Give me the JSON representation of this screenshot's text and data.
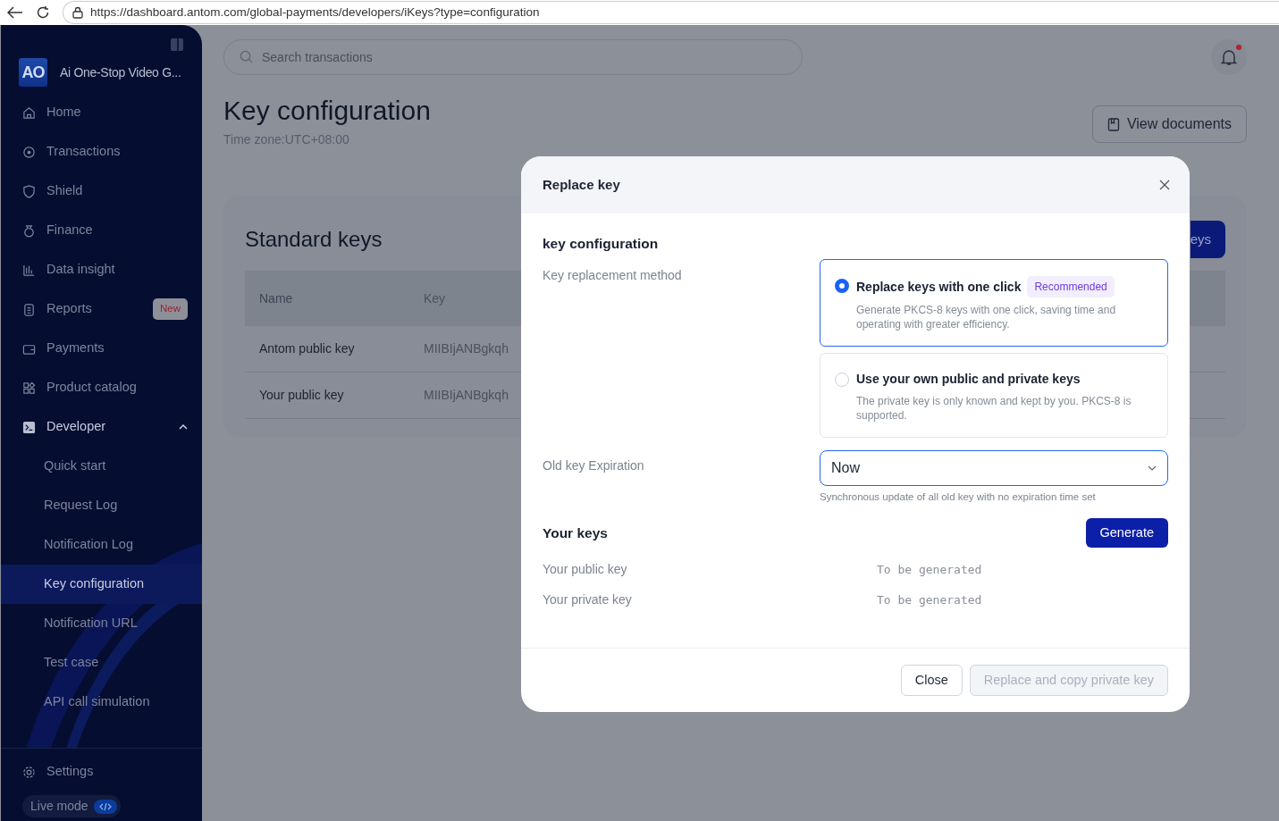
{
  "browser": {
    "url": "https://dashboard.antom.com/global-payments/developers/iKeys?type=configuration"
  },
  "sidebar": {
    "logo": "AO",
    "merchant": "Ai One-Stop Video G...",
    "items": [
      {
        "label": "Home",
        "selected": false
      },
      {
        "label": "Transactions",
        "selected": false
      },
      {
        "label": "Shield",
        "selected": false
      },
      {
        "label": "Finance",
        "selected": false
      },
      {
        "label": "Data insight",
        "selected": false
      },
      {
        "label": "Reports",
        "selected": false,
        "badge": "New"
      },
      {
        "label": "Payments",
        "selected": false
      },
      {
        "label": "Product catalog",
        "selected": false
      },
      {
        "label": "Developer",
        "selected": false,
        "expanded": true,
        "children": [
          {
            "label": "Quick start",
            "selected": false
          },
          {
            "label": "Request Log",
            "selected": false
          },
          {
            "label": "Notification Log",
            "selected": false
          },
          {
            "label": "Key configuration",
            "selected": true
          },
          {
            "label": "Notification URL",
            "selected": false
          },
          {
            "label": "Test case",
            "selected": false
          },
          {
            "label": "API call simulation",
            "selected": false
          }
        ]
      }
    ],
    "settings": "Settings",
    "live_mode": "Live mode"
  },
  "search": {
    "placeholder": "Search transactions"
  },
  "notifications": {
    "unread": true
  },
  "page": {
    "title": "Key configuration",
    "timezone": "Time zone:UTC+08:00",
    "docs_button": "View documents"
  },
  "standard_keys": {
    "title": "Standard keys",
    "button_partial": "eys",
    "columns": [
      "Name",
      "Key"
    ],
    "rows": [
      [
        "Antom public key",
        "MIIBIjANBgkqh"
      ],
      [
        "Your public key",
        "MIIBIjANBgkqh"
      ]
    ]
  },
  "modal": {
    "title": "Replace key",
    "section": "key configuration",
    "method_label": "Key replacement method",
    "options": [
      {
        "title": "Replace keys with one click",
        "tag": "Recommended",
        "description": "Generate PKCS-8 keys with one click, saving time and operating with greater efficiency.",
        "selected": true
      },
      {
        "title": "Use your own public and private keys",
        "description": "The private key is only known and kept by you. PKCS-8 is supported.",
        "selected": false
      }
    ],
    "expiration_label": "Old key Expiration",
    "expiration_value": "Now",
    "expiration_hint": "Synchronous update of all old key with no expiration time set",
    "keys_title": "Your keys",
    "generate_button": "Generate",
    "keys": [
      {
        "label": "Your public key",
        "value": "To be generated"
      },
      {
        "label": "Your private key",
        "value": "To be generated"
      }
    ],
    "buttons": [
      {
        "label": "Close",
        "disabled": false
      },
      {
        "label": "Replace and copy private key",
        "disabled": true
      }
    ]
  }
}
